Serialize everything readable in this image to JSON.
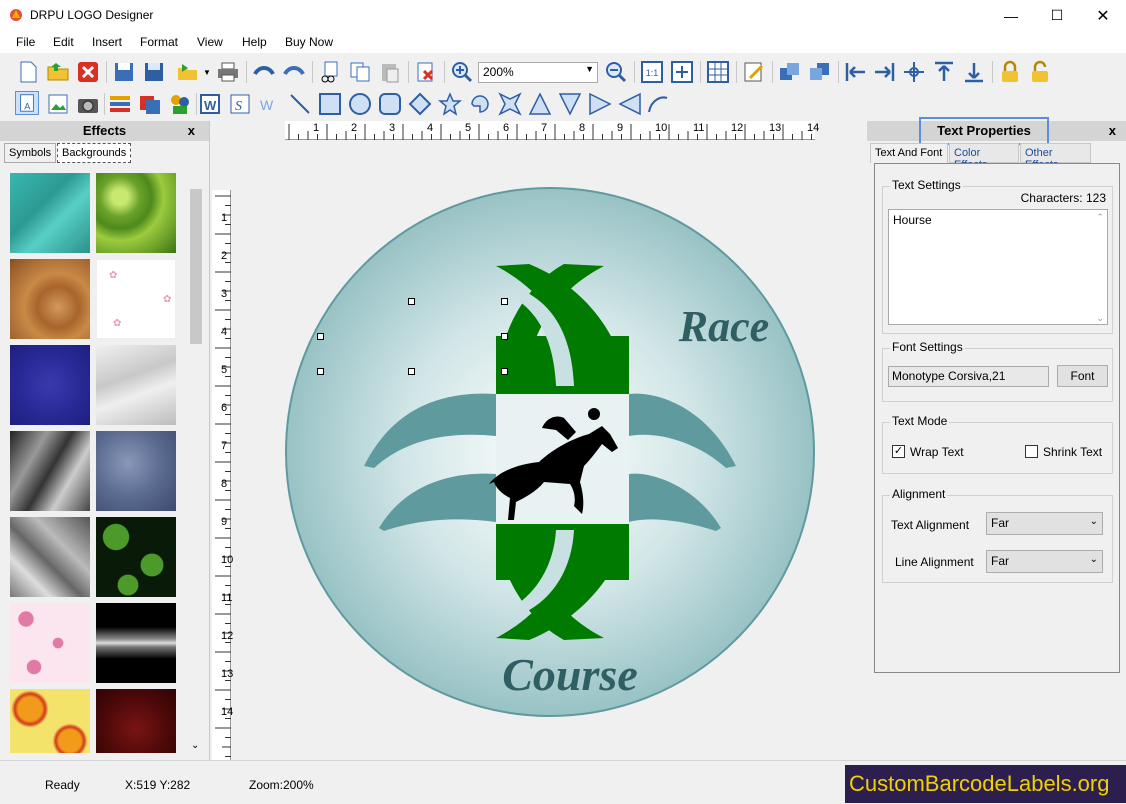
{
  "window": {
    "title": "DRPU LOGO Designer"
  },
  "menu": [
    "File",
    "Edit",
    "Insert",
    "Format",
    "View",
    "Help",
    "Buy Now"
  ],
  "toolbar": {
    "zoom_value": "200%"
  },
  "effects_panel": {
    "title": "Effects",
    "close": "x",
    "tabs": [
      "Symbols",
      "Backgrounds"
    ],
    "active_tab": "Backgrounds"
  },
  "ruler": {
    "h_ticks": [
      "1",
      "2",
      "3",
      "4",
      "5",
      "6",
      "7",
      "8",
      "9",
      "10",
      "11",
      "12",
      "13",
      "14"
    ],
    "v_ticks": [
      "1",
      "2",
      "3",
      "4",
      "5",
      "6",
      "7",
      "8",
      "9",
      "10",
      "11",
      "12",
      "13",
      "14"
    ]
  },
  "logo": {
    "top_text": "Race",
    "bottom_text": "Course"
  },
  "text_properties": {
    "title": "Text Properties",
    "close": "x",
    "tabs": [
      "Text And Font",
      "Color Effects",
      "Other Effects"
    ],
    "text_settings_label": "Text Settings",
    "characters_label": "Characters: 123",
    "text_value": "Hourse",
    "font_settings_label": "Font Settings",
    "font_value": "Monotype Corsiva,21",
    "font_button": "Font",
    "text_mode_label": "Text Mode",
    "wrap_text": "Wrap Text",
    "wrap_checked": "✓",
    "shrink_text": "Shrink Text",
    "alignment_label": "Alignment",
    "text_alignment_label": "Text Alignment",
    "text_alignment_value": "Far",
    "line_alignment_label": "Line Alignment",
    "line_alignment_value": "Far"
  },
  "status": {
    "ready": "Ready",
    "coords": "X:519  Y:282",
    "zoom": "Zoom:200%"
  },
  "brand": "CustomBarcodeLabels.org",
  "colors": {
    "logo_green": "#007a00",
    "logo_teal": "#5f9a9e",
    "text_teal": "#2f5e63"
  }
}
